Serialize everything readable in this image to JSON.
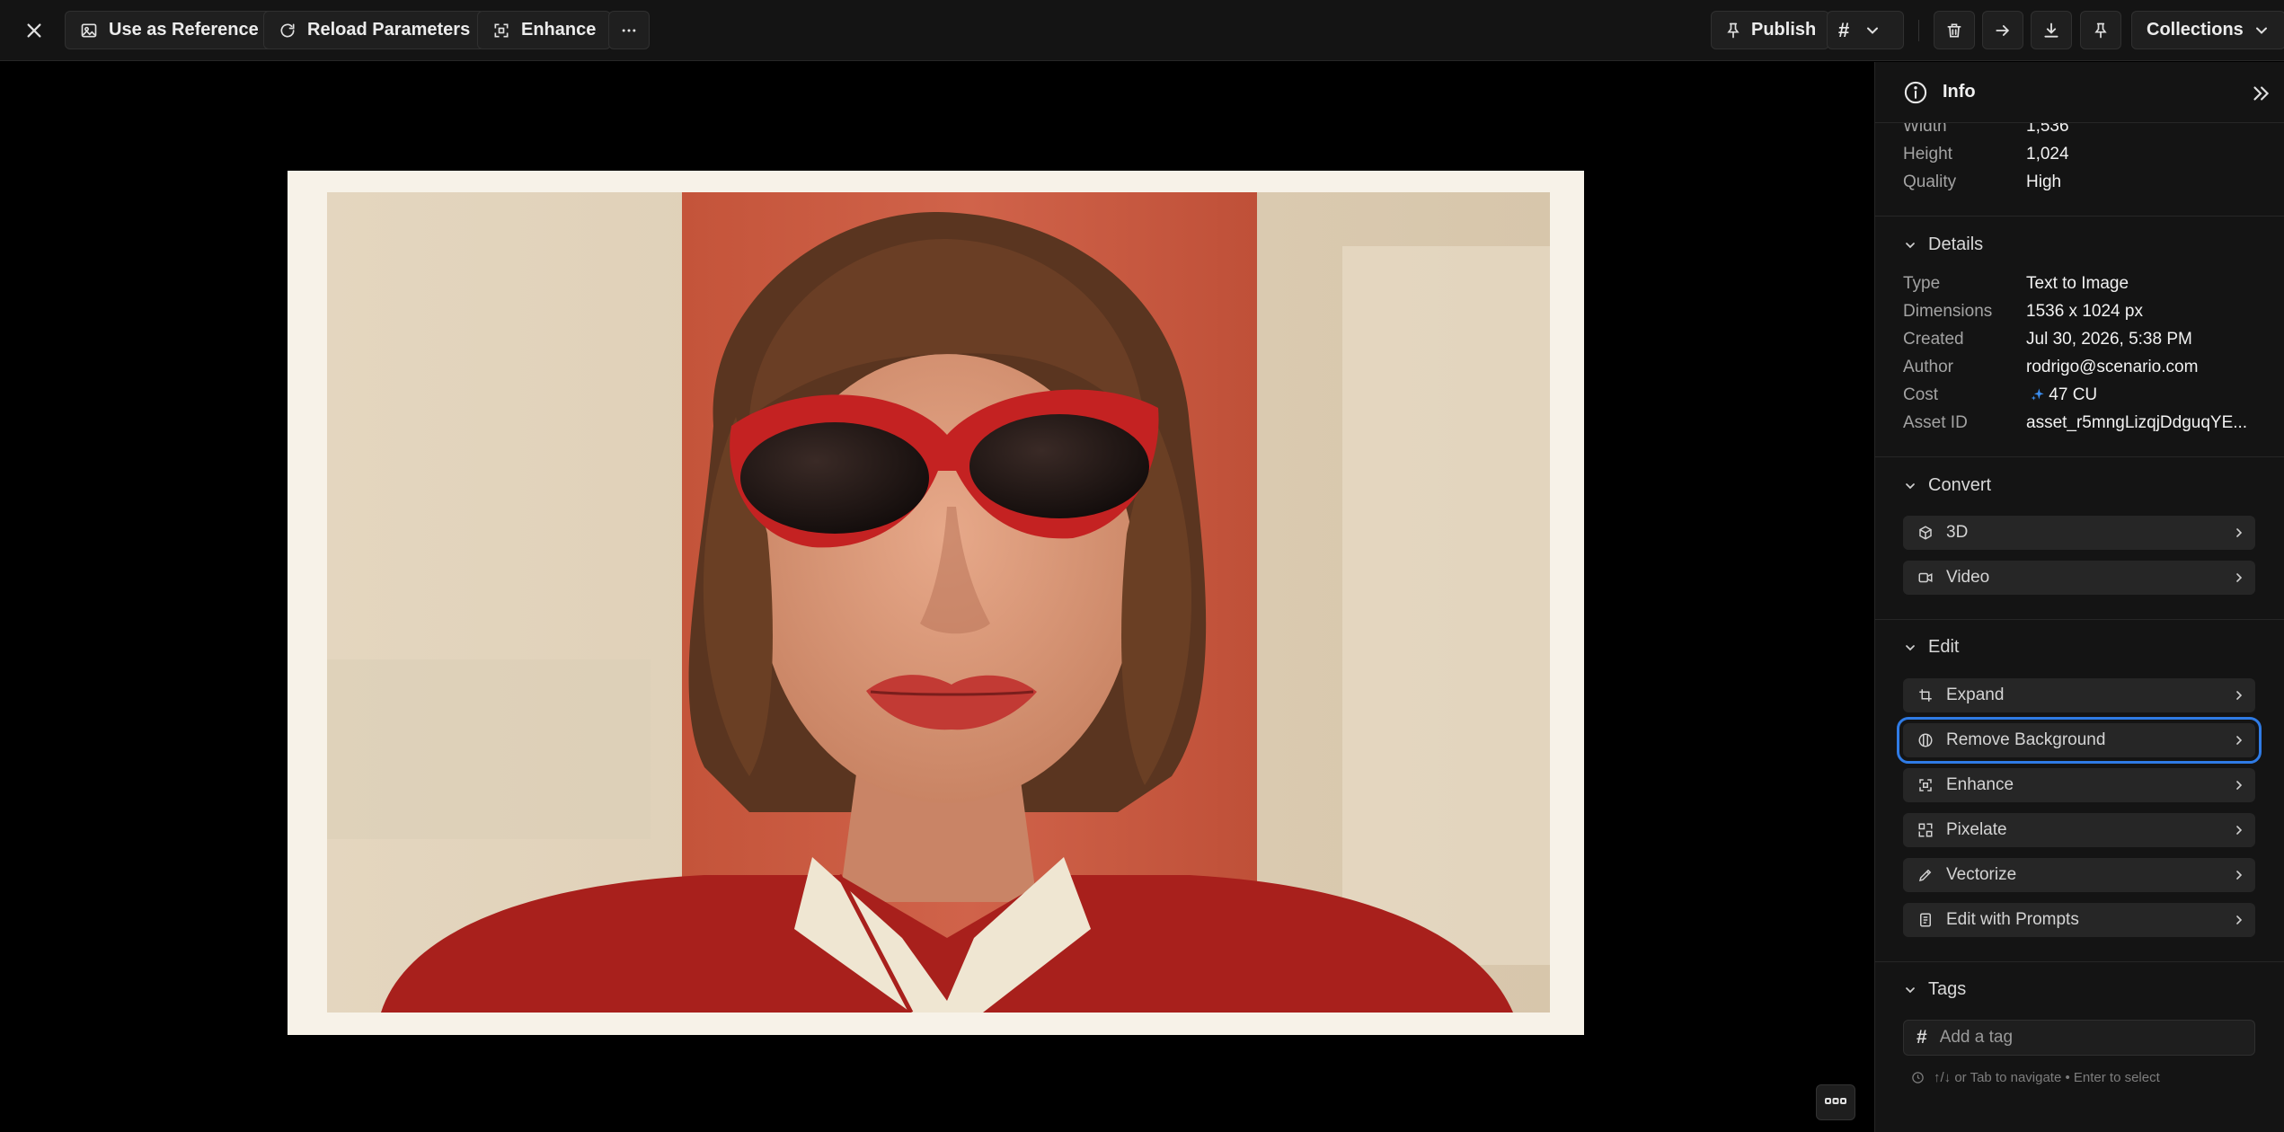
{
  "toolbar": {
    "use_as_reference": "Use as Reference",
    "reload_parameters": "Reload Parameters",
    "enhance": "Enhance",
    "publish": "Publish",
    "hash": "#",
    "collections": "Collections"
  },
  "panel": {
    "title": "Info",
    "image_props": [
      {
        "key": "Width",
        "value": "1,536"
      },
      {
        "key": "Height",
        "value": "1,024"
      },
      {
        "key": "Quality",
        "value": "High"
      }
    ],
    "details": {
      "heading": "Details",
      "rows": [
        {
          "key": "Type",
          "value": "Text to Image"
        },
        {
          "key": "Dimensions",
          "value": "1536 x 1024 px"
        },
        {
          "key": "Created",
          "value": "Jul 30, 2026, 5:38 PM"
        },
        {
          "key": "Author",
          "value": "rodrigo@scenario.com"
        },
        {
          "key": "Cost",
          "value": "47 CU"
        },
        {
          "key": "Asset ID",
          "value": "asset_r5mngLizqjDdguqYE..."
        }
      ]
    },
    "convert": {
      "heading": "Convert",
      "items": [
        {
          "label": "3D",
          "icon": "cube-icon"
        },
        {
          "label": "Video",
          "icon": "video-icon"
        }
      ]
    },
    "edit": {
      "heading": "Edit",
      "items": [
        {
          "label": "Expand",
          "icon": "expand-icon"
        },
        {
          "label": "Remove Background",
          "icon": "remove-background-icon"
        },
        {
          "label": "Enhance",
          "icon": "enhance-icon"
        },
        {
          "label": "Pixelate",
          "icon": "pixelate-icon"
        },
        {
          "label": "Vectorize",
          "icon": "vectorize-icon"
        },
        {
          "label": "Edit with Prompts",
          "icon": "prompt-icon"
        }
      ]
    },
    "tags": {
      "heading": "Tags",
      "placeholder": "Add a tag",
      "hint": "↑/↓ or Tab to navigate • Enter to select"
    }
  },
  "colors": {
    "accent_focus": "#2f7be5",
    "cost_icon": "#3b8ef0"
  }
}
